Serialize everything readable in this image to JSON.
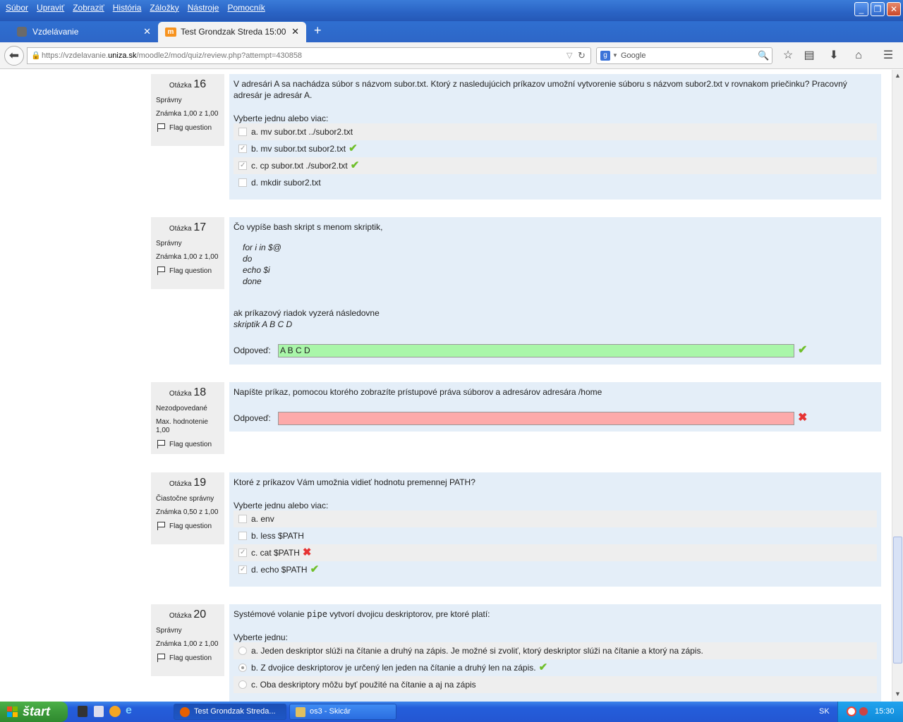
{
  "menubar": [
    "Súbor",
    "Upraviť",
    "Zobraziť",
    "História",
    "Záložky",
    "Nástroje",
    "Pomocník"
  ],
  "tabs": [
    {
      "label": "Vzdelávanie",
      "active": false
    },
    {
      "label": "Test Grondzak Streda 15:00",
      "active": true
    }
  ],
  "url": {
    "prefix": "https://vzdelavanie.",
    "domain": "uniza.sk",
    "path": "/moodle2/mod/quiz/review.php?attempt=430858"
  },
  "search": {
    "placeholder": "Google"
  },
  "questions": {
    "q16": {
      "label": "Otázka",
      "number": "16",
      "state": "Správny",
      "grade": "Známka 1,00 z 1,00",
      "flag": "Flag question",
      "text": "V adresári A sa nachádza súbor s názvom subor.txt. Ktorý z nasledujúcich príkazov umožní vytvorenie súboru s názvom subor2.txt v rovnakom priečinku? Pracovný adresár je adresár A.",
      "prompt": "Vyberte jednu alebo viac:",
      "options": [
        {
          "text": "a. mv subor.txt ../subor2.txt",
          "checked": false,
          "mark": ""
        },
        {
          "text": "b. mv subor.txt subor2.txt",
          "checked": true,
          "mark": "✔"
        },
        {
          "text": "c. cp subor.txt ./subor2.txt",
          "checked": true,
          "mark": "✔"
        },
        {
          "text": "d. mkdir subor2.txt",
          "checked": false,
          "mark": ""
        }
      ]
    },
    "q17": {
      "label": "Otázka",
      "number": "17",
      "state": "Správny",
      "grade": "Známka 1,00 z 1,00",
      "flag": "Flag question",
      "text": "Čo vypíše bash skript s menom skriptik,",
      "code": [
        "for i in $@",
        "do",
        "echo $i",
        "done"
      ],
      "text2": "ak príkazový riadok vyzerá následovne",
      "cmd": "skriptik A B C D",
      "answer_label": "Odpoveď:",
      "answer": "A B C D",
      "mark": "✔"
    },
    "q18": {
      "label": "Otázka",
      "number": "18",
      "state": "Nezodpovedané",
      "grade": "Max. hodnotenie 1,00",
      "flag": "Flag question",
      "text": "Napíšte príkaz, pomocou ktorého zobrazíte prístupové práva súborov a adresárov adresára /home",
      "answer_label": "Odpoveď:",
      "answer": "",
      "mark": "✖"
    },
    "q19": {
      "label": "Otázka",
      "number": "19",
      "state": "Čiastočne správny",
      "grade": "Známka 0,50 z 1,00",
      "flag": "Flag question",
      "text": "Ktoré z príkazov Vám umožnia vidieť hodnotu premennej PATH?",
      "prompt": "Vyberte jednu alebo viac:",
      "options": [
        {
          "text": "a. env",
          "checked": false,
          "mark": ""
        },
        {
          "text": "b. less $PATH",
          "checked": false,
          "mark": ""
        },
        {
          "text": "c. cat $PATH",
          "checked": true,
          "mark": "✖"
        },
        {
          "text": "d. echo $PATH",
          "checked": true,
          "mark": "✔"
        }
      ]
    },
    "q20": {
      "label": "Otázka",
      "number": "20",
      "state": "Správny",
      "grade": "Známka 1,00 z 1,00",
      "flag": "Flag question",
      "text_pre": "Systémové volanie ",
      "text_code": "pipe",
      "text_post": " vytvorí dvojicu deskriptorov, pre ktoré platí:",
      "prompt": "Vyberte jednu:",
      "options": [
        {
          "text": "a. Jeden deskriptor slúži na čítanie a druhý na zápis. Je možné si zvoliť, ktorý deskriptor slúži na čítanie a ktorý na zápis.",
          "checked": false,
          "mark": ""
        },
        {
          "text": "b. Z dvojice deskriptorov je určený len jeden na čítanie a druhý len na zápis.",
          "checked": true,
          "mark": "✔"
        },
        {
          "text": "c. Oba deskriptory môžu byť použité na čítanie a aj na zápis",
          "checked": false,
          "mark": ""
        }
      ]
    }
  },
  "taskbar": {
    "start": "štart",
    "tasks": [
      "Test Grondzak Streda...",
      "os3 - Skicár"
    ],
    "lang": "SK",
    "clock": "15:30"
  },
  "colors": {
    "correct_bg": "#a9f6a9",
    "wrong_bg": "#fdaaaa",
    "question_bg": "#e4eef8",
    "info_bg": "#eeeeee"
  }
}
